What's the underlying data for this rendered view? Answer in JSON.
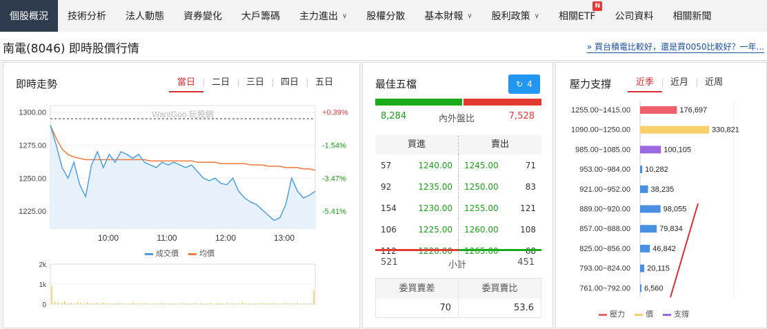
{
  "nav": {
    "items": [
      {
        "label": "個股概況",
        "active": true,
        "chevron": false
      },
      {
        "label": "技術分析",
        "chevron": false
      },
      {
        "label": "法人動態",
        "chevron": false
      },
      {
        "label": "資券變化",
        "chevron": false
      },
      {
        "label": "大戶籌碼",
        "chevron": false
      },
      {
        "label": "主力進出",
        "chevron": true
      },
      {
        "label": "股權分散",
        "chevron": false
      },
      {
        "label": "基本財報",
        "chevron": true
      },
      {
        "label": "股利政策",
        "chevron": true
      },
      {
        "label": "相關ETF",
        "chevron": false,
        "badge": "N"
      },
      {
        "label": "公司資料",
        "chevron": false
      },
      {
        "label": "相關新聞",
        "chevron": false
      }
    ]
  },
  "header": {
    "title": "南電(8046) 即時股價行情",
    "promo": "» 買台積電比較好，還是買0050比較好？一年..."
  },
  "intraday": {
    "title": "即時走勢",
    "tabs": [
      "當日",
      "二日",
      "三日",
      "四日",
      "五日"
    ],
    "watermark": "WantGoo 玩股網",
    "legend_price": "成交價",
    "legend_avg": "均價",
    "colors": {
      "price": "#4a9fe0",
      "avg": "#f07838",
      "volume": "#f0b400"
    }
  },
  "chart_data": {
    "type": "line",
    "title": "",
    "xlabel": "",
    "ylabel": "",
    "ylim": [
      1212,
      1305
    ],
    "x_ticks": [
      "10:00",
      "11:00",
      "12:00",
      "13:00"
    ],
    "y_ticks": [
      1300,
      1275,
      1250,
      1225
    ],
    "y_tick_labels": [
      "1300.00",
      "1275.00",
      "1250.00",
      "1225.00"
    ],
    "pct_ticks": [
      "+0.39%",
      "-1.54%",
      "-3.47%",
      "-5.41%"
    ],
    "reference": 1295,
    "series": [
      {
        "name": "成交價",
        "values": [
          1290,
          1275,
          1258,
          1250,
          1262,
          1245,
          1236,
          1260,
          1270,
          1258,
          1268,
          1262,
          1270,
          1268,
          1265,
          1268,
          1262,
          1260,
          1258,
          1262,
          1260,
          1262,
          1260,
          1258,
          1260,
          1255,
          1250,
          1248,
          1250,
          1246,
          1245,
          1250,
          1240,
          1235,
          1232,
          1230,
          1226,
          1222,
          1218,
          1220,
          1230,
          1250,
          1240,
          1235,
          1237,
          1240
        ]
      },
      {
        "name": "均價",
        "values": [
          1290,
          1280,
          1272,
          1268,
          1266,
          1265,
          1264,
          1264,
          1264,
          1264,
          1264,
          1264,
          1264,
          1264,
          1264,
          1264,
          1264,
          1263,
          1263,
          1263,
          1263,
          1263,
          1263,
          1263,
          1263,
          1262,
          1262,
          1262,
          1262,
          1261,
          1261,
          1261,
          1261,
          1261,
          1260,
          1260,
          1260,
          1259,
          1259,
          1259,
          1258,
          1258,
          1258,
          1257,
          1257,
          1256
        ]
      }
    ],
    "volume": {
      "y_ticks": [
        "2k",
        "1k",
        "0"
      ],
      "ylim": [
        0,
        2000
      ],
      "values": [
        900,
        120,
        80,
        60,
        150,
        50,
        70,
        40,
        100,
        60,
        30,
        80,
        50,
        40,
        60,
        30,
        90,
        50,
        40,
        30,
        60,
        40,
        50,
        30,
        40,
        80,
        30,
        50,
        40,
        60,
        30,
        40,
        50,
        30,
        60,
        40,
        30,
        50,
        40,
        30,
        60,
        50,
        40,
        30,
        60,
        40,
        50,
        30,
        40,
        60,
        30,
        50,
        40,
        30,
        60,
        40,
        50,
        30,
        40,
        80,
        50,
        40,
        30,
        50,
        40,
        60,
        30,
        50,
        40,
        60,
        40,
        30,
        60,
        50,
        40,
        30,
        60,
        40,
        50,
        30,
        40,
        700
      ]
    }
  },
  "orderbook": {
    "title": "最佳五檔",
    "refresh_count": "4",
    "inner": "8,284",
    "outer": "7,528",
    "ratio_label": "內外盤比",
    "inner_ratio": 0.524,
    "buy_header": "買進",
    "sell_header": "賣出",
    "rows": [
      {
        "bq": "57",
        "bp": "1240.00",
        "sp": "1245.00",
        "sq": "71"
      },
      {
        "bq": "92",
        "bp": "1235.00",
        "sp": "1250.00",
        "sq": "83"
      },
      {
        "bq": "154",
        "bp": "1230.00",
        "sp": "1255.00",
        "sq": "121"
      },
      {
        "bq": "106",
        "bp": "1225.00",
        "sp": "1260.00",
        "sq": "108"
      },
      {
        "bq": "112",
        "bp": "1220.00",
        "sp": "1265.00",
        "sq": "68"
      }
    ],
    "subtotal_label": "小計",
    "buy_total": "521",
    "sell_total": "451",
    "diff_label": "委買賣差",
    "ratio2_label": "委買賣比",
    "diff_value": "70",
    "ratio2_value": "53.6"
  },
  "pressure": {
    "title": "壓力支撐",
    "tabs": [
      "近季",
      "近月",
      "近周"
    ],
    "legend": [
      "壓力",
      "價",
      "支撐"
    ],
    "colors": {
      "pressure": "#f0606a",
      "price": "#f8d06a",
      "support": "#9b6ae0",
      "bar": "#4a90e2",
      "trend": "#d32f2f"
    },
    "rows": [
      {
        "range": "1255.00~1415.00",
        "value": "176,697",
        "num": 176697,
        "kind": "pressure"
      },
      {
        "range": "1090.00~1250.00",
        "value": "330,821",
        "num": 330821,
        "kind": "price"
      },
      {
        "range": "985.00~1085.00",
        "value": "100,105",
        "num": 100105,
        "kind": "support"
      },
      {
        "range": "953.00~984.00",
        "value": "10,282",
        "num": 10282,
        "kind": "bar"
      },
      {
        "range": "921.00~952.00",
        "value": "38,235",
        "num": 38235,
        "kind": "bar"
      },
      {
        "range": "889.00~920.00",
        "value": "98,055",
        "num": 98055,
        "kind": "bar"
      },
      {
        "range": "857.00~888.00",
        "value": "79,834",
        "num": 79834,
        "kind": "bar"
      },
      {
        "range": "825.00~856.00",
        "value": "46,842",
        "num": 46842,
        "kind": "bar"
      },
      {
        "range": "793.00~824.00",
        "value": "20,115",
        "num": 20115,
        "kind": "bar"
      },
      {
        "range": "761.00~792.00",
        "value": "6,560",
        "num": 6560,
        "kind": "bar"
      }
    ]
  }
}
